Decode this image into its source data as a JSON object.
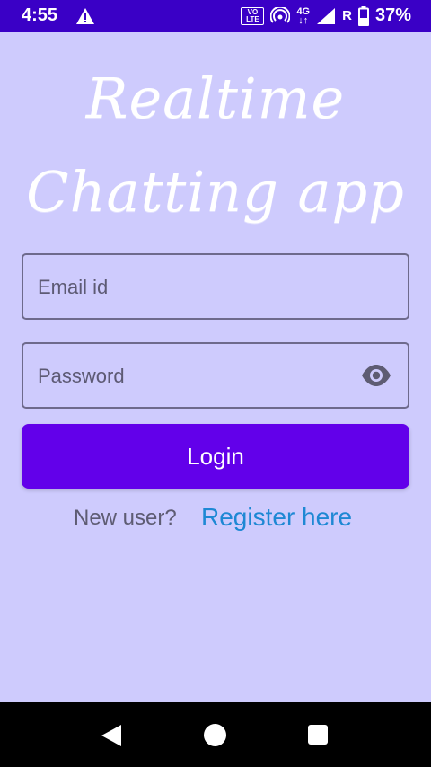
{
  "status_bar": {
    "time": "4:55",
    "volte_top": "VO",
    "volte_bottom": "LTE",
    "network": "4G",
    "roaming": "R",
    "battery": "37%",
    "icons": [
      "warning-icon",
      "volte-icon",
      "hotspot-icon",
      "4g-data-icon",
      "signal-icon",
      "roaming-indicator",
      "battery-icon"
    ]
  },
  "title": {
    "line1": "Realtime",
    "line2": "Chatting app"
  },
  "form": {
    "email_placeholder": "Email id",
    "password_placeholder": "Password",
    "login_label": "Login",
    "new_user_text": "New user?",
    "register_label": "Register here"
  },
  "colors": {
    "status_bar": "#3a00c6",
    "background": "#cecbfd",
    "button": "#6200ea",
    "link": "#1e88d4",
    "nav_bar": "#000000"
  },
  "nav_bar": {
    "icons": [
      "back-icon",
      "home-icon",
      "recents-icon"
    ]
  }
}
